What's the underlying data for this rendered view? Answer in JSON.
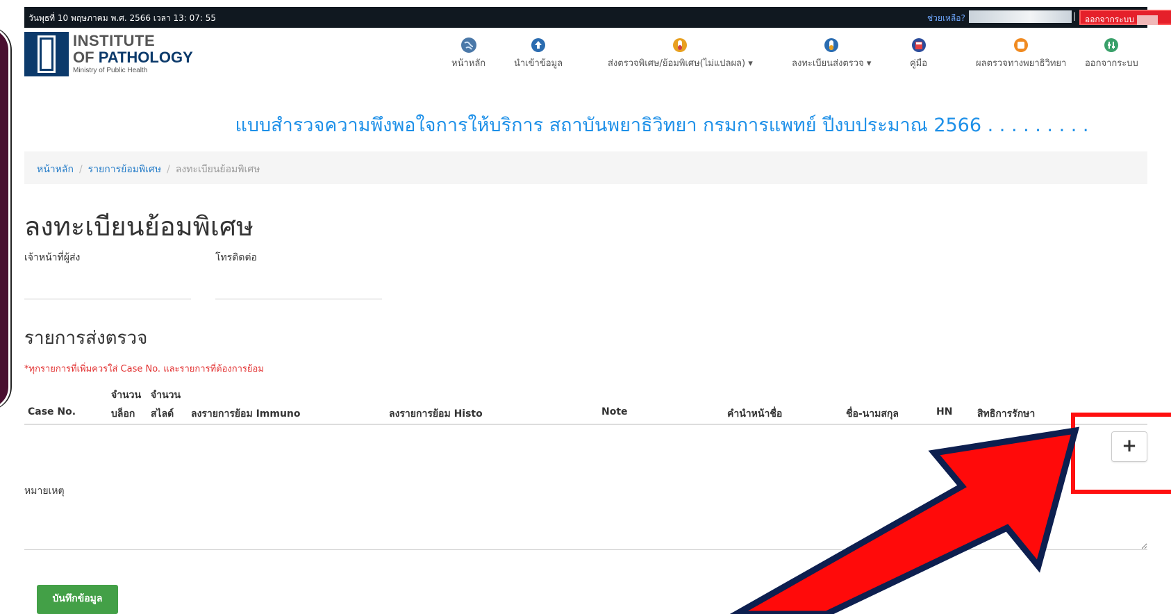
{
  "topbar": {
    "datetime": "วันพุธที่ 10 พฤษภาคม พ.ศ. 2566 เวลา 13: 07: 55",
    "help_label": "ช่วยเหลือ?",
    "pipe": "|",
    "logout_label": "ออกจากระบบ"
  },
  "logo": {
    "line1": "INSTITUTE",
    "line2_of": "OF",
    "line2_name": "PATHOLOGY",
    "line3": "Ministry of Public Health"
  },
  "nav": {
    "items": [
      {
        "label": "หน้าหลัก",
        "icon": "globe-icon",
        "color": "#4a78a8"
      },
      {
        "label": "นำเข้าข้อมูล",
        "icon": "upload-icon",
        "color": "#2b6cb0"
      },
      {
        "label": "ส่งตรวจพิเศษ/ย้อมพิเศษ(ไม่แปลผล) ▾",
        "icon": "tube-icon",
        "color": "#e8a020"
      },
      {
        "label": "ลงทะเบียนส่งตรวจ ▾",
        "icon": "tube-icon",
        "color": "#2b6cb0"
      },
      {
        "label": "คู่มือ",
        "icon": "book-icon",
        "color": "#2b4c9b"
      },
      {
        "label": "ผลตรวจทางพยาธิวิทยา",
        "icon": "report-icon",
        "color": "#f08a20"
      },
      {
        "label": "ออกจากระบบ",
        "icon": "settings-icon",
        "color": "#3aa06a"
      }
    ]
  },
  "survey_title": "แบบสำรวจความพึงพอใจการให้บริการ สถาบันพยาธิวิทยา กรมการแพทย์ ปีงบประมาณ 2566 . . . . . . . . .",
  "breadcrumb": {
    "home": "หน้าหลัก",
    "list": "รายการย้อมพิเศษ",
    "current": "ลงทะเบียนย้อมพิเศษ",
    "separator": "/"
  },
  "page_title": "ลงทะเบียนย้อมพิเศษ",
  "fields": {
    "sender_label": "เจ้าหน้าที่ผู้ส่ง",
    "phone_label": "โทรติดต่อ"
  },
  "section_title": "รายการส่งตรวจ",
  "warning": "*ทุกรายการที่เพิ่มควรใส่ Case No. และรายการที่ต้องการย้อม",
  "table": {
    "headers": {
      "case_no": "Case No.",
      "block_top": "จำนวน",
      "block_bottom": "บล็อก",
      "slide_top": "จำนวน",
      "slide_bottom": "สไลด์",
      "immuno": "ลงรายการย้อม Immuno",
      "histo": "ลงรายการย้อม Histo",
      "note": "Note",
      "prefix": "คำนำหน้าชื่อ",
      "fullname": "ชื่อ-นามสกุล",
      "hn": "HN",
      "rights": "สิทธิการรักษา"
    },
    "add_button": "+"
  },
  "remark_label": "หมายเหตุ",
  "save_button": "บันทึกข้อมูล",
  "colors": {
    "accent_blue": "#1e90e8",
    "highlight_red": "#ff1010",
    "save_green": "#43a047",
    "arrow_outline": "#0d1f4f"
  }
}
